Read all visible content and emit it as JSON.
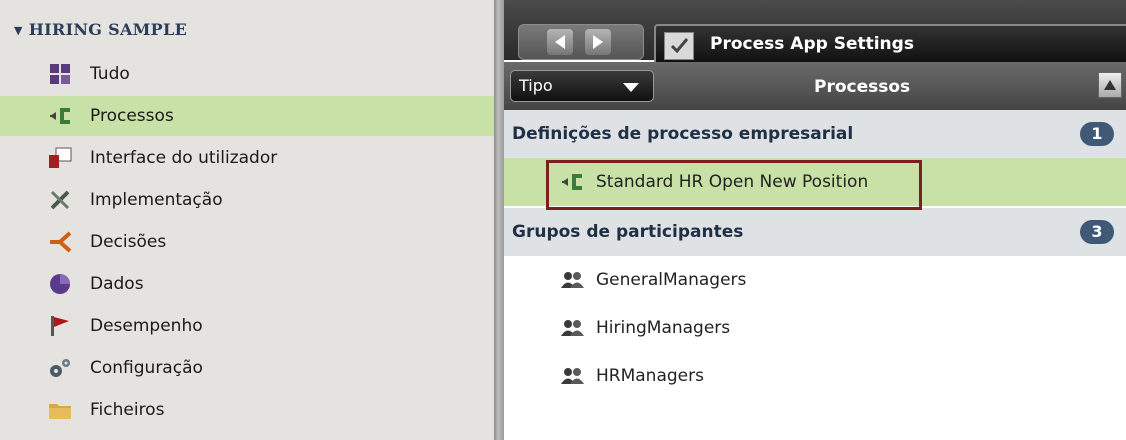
{
  "library": {
    "header": "HIRING SAMPLE",
    "items": [
      {
        "label": "Tudo",
        "icon": "grid-icon"
      },
      {
        "label": "Processos",
        "icon": "process-icon"
      },
      {
        "label": "Interface do utilizador",
        "icon": "user-interface-icon"
      },
      {
        "label": "Implementação",
        "icon": "tools-icon"
      },
      {
        "label": "Decisões",
        "icon": "decision-icon"
      },
      {
        "label": "Dados",
        "icon": "data-icon"
      },
      {
        "label": "Desempenho",
        "icon": "flag-icon"
      },
      {
        "label": "Configuração",
        "icon": "gears-icon"
      },
      {
        "label": "Ficheiros",
        "icon": "folder-icon"
      }
    ],
    "selected": "Processos"
  },
  "tab": {
    "title": "Process App Settings"
  },
  "toolbar": {
    "filter_label": "Tipo",
    "panel_title": "Processos"
  },
  "sections": [
    {
      "title": "Definições de processo empresarial",
      "count": "1",
      "items": [
        {
          "label": "Standard HR Open New Position",
          "icon": "process-icon"
        }
      ]
    },
    {
      "title": "Grupos de participantes",
      "count": "3",
      "items": [
        {
          "label": "GeneralManagers",
          "icon": "group-icon"
        },
        {
          "label": "HiringManagers",
          "icon": "group-icon"
        },
        {
          "label": "HRManagers",
          "icon": "group-icon"
        }
      ]
    }
  ],
  "colors": {
    "selected_row": "#c7e1a6",
    "badge": "#3f5977",
    "highlight_border": "#7c1f22"
  }
}
